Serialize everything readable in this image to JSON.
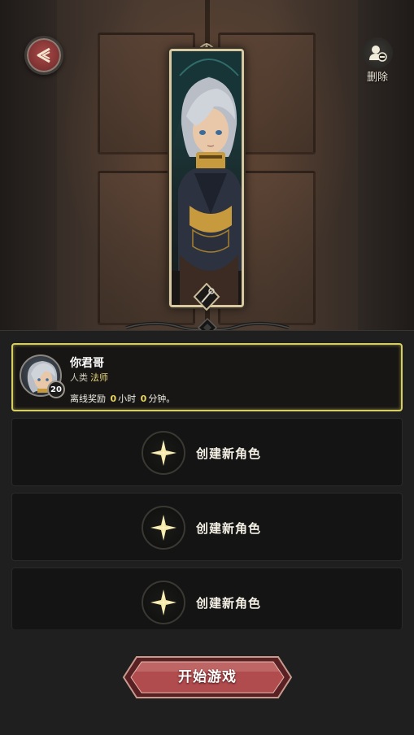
{
  "top_bar": {
    "back_icon": "back-chevron-icon",
    "delete_label": "删除",
    "delete_icon": "delete-user-icon"
  },
  "character": {
    "name": "你君哥",
    "race": "人类",
    "class": "法师",
    "level": "20",
    "offline_prefix": "离线奖励",
    "offline_hours": "0",
    "offline_hours_unit": "小时",
    "offline_minutes": "0",
    "offline_minutes_unit": "分钟。"
  },
  "empty_slots": [
    {
      "label": "创建新角色",
      "icon": "plus-cross-icon"
    },
    {
      "label": "创建新角色",
      "icon": "plus-cross-icon"
    },
    {
      "label": "创建新角色",
      "icon": "plus-cross-icon"
    }
  ],
  "start_button": {
    "label": "开始游戏"
  },
  "colors": {
    "accent_gold": "#d8cf63",
    "start_red": "#b24a4d",
    "back_red": "#8a3536"
  }
}
